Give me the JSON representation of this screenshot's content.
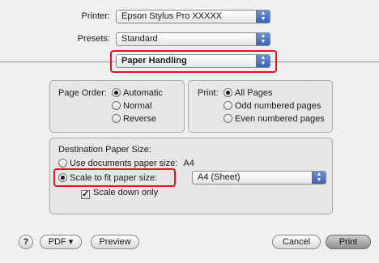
{
  "printer": {
    "label": "Printer:",
    "value": "Epson Stylus Pro XXXXX"
  },
  "presets": {
    "label": "Presets:",
    "value": "Standard"
  },
  "panel_select": {
    "value": "Paper Handling"
  },
  "page_order": {
    "label": "Page Order:",
    "options": [
      "Automatic",
      "Normal",
      "Reverse"
    ],
    "selected": "Automatic"
  },
  "print": {
    "label": "Print:",
    "options": [
      "All Pages",
      "Odd numbered pages",
      "Even numbered pages"
    ],
    "selected": "All Pages"
  },
  "destination": {
    "title": "Destination Paper Size:",
    "use_documents": {
      "label": "Use documents paper size:",
      "size": "A4"
    },
    "scale_to_fit": {
      "label": "Scale to fit paper size:",
      "value": "A4 (Sheet)"
    },
    "scale_down_only": {
      "label": "Scale down only",
      "checked": true
    }
  },
  "footer": {
    "help": "?",
    "pdf": "PDF ▾",
    "preview": "Preview",
    "cancel": "Cancel",
    "print": "Print"
  },
  "colors": {
    "highlight": "#e0141c",
    "popup_arrows": "#3a63b8"
  }
}
